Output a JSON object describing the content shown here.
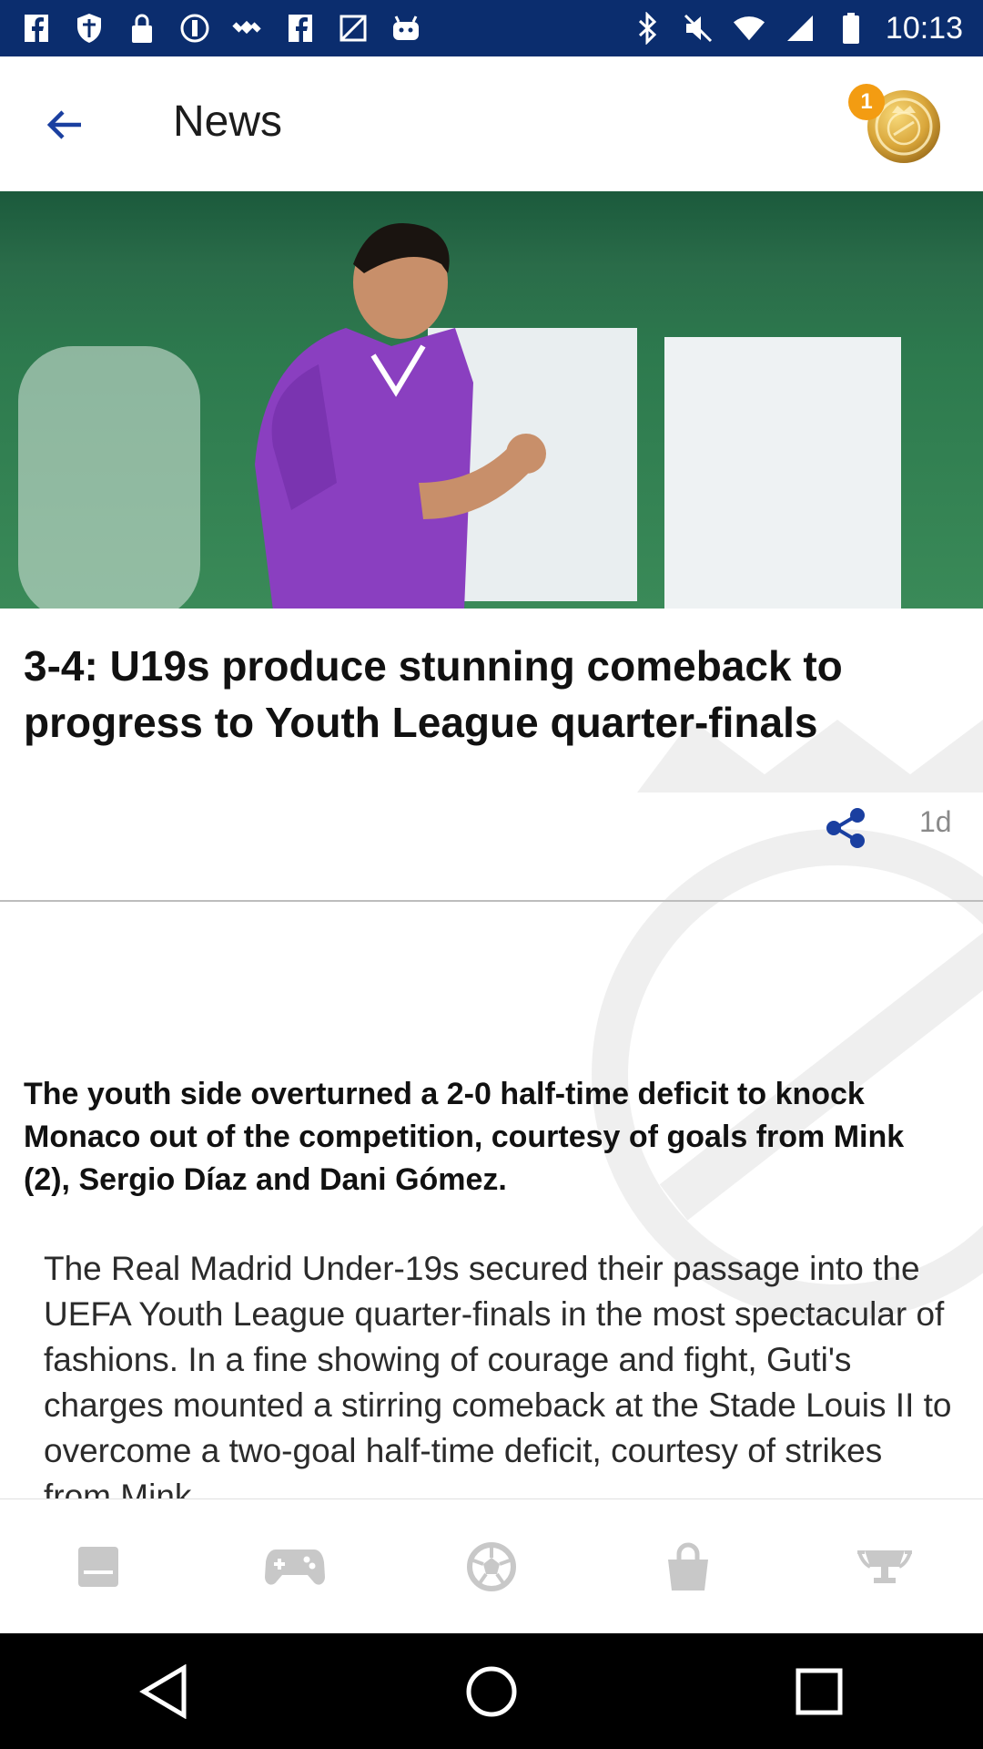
{
  "status_bar": {
    "time": "10:13",
    "left_icons": [
      "facebook-icon",
      "shield-icon",
      "lock-icon",
      "vpn-icon",
      "satellite-icon",
      "facebook-icon",
      "maps-icon",
      "android-icon"
    ],
    "right_icons": [
      "bluetooth-icon",
      "mute-icon",
      "wifi-icon",
      "signal-icon",
      "battery-icon"
    ]
  },
  "app_bar": {
    "title": "News",
    "badge_count": "1"
  },
  "article": {
    "headline": "3-4: U19s produce stunning comeback to progress to Youth League quarter-finals",
    "age": "1d",
    "lead": "The youth side overturned a 2-0 half-time deficit to knock Monaco out of the competition, courtesy of goals from Mink (2), Sergio Díaz and Dani Gómez.",
    "body": "The Real Madrid Under-19s secured their passage into the UEFA Youth League quarter-finals in the most spectacular of fashions. In a fine showing of courage and fight, Guti's charges mounted a stirring comeback at the Stade Louis II to overcome a two-goal half-time deficit, courtesy of strikes from Mink"
  },
  "bottom_nav": {
    "items": [
      "news-icon",
      "gamepad-icon",
      "football-icon",
      "shopping-bag-icon",
      "trophy-icon"
    ]
  },
  "colors": {
    "status_bar": "#0b2d6e",
    "accent_blue": "#1a3fa0",
    "badge": "#f39c12",
    "nav_icon": "#c8c8c8"
  }
}
